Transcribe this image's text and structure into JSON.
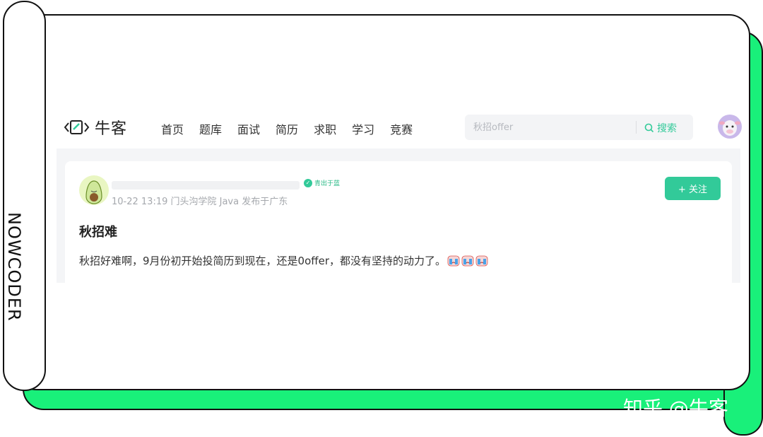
{
  "frame": {
    "side_label": "NOWCODER",
    "watermark": "知乎 @牛客",
    "accent_color": "#19f07a"
  },
  "header": {
    "logo_text": "牛客",
    "nav": [
      "首页",
      "题库",
      "面试",
      "简历",
      "求职",
      "学习",
      "竞赛"
    ],
    "search": {
      "placeholder": "秋招offer",
      "button_label": "搜索"
    },
    "brand_color": "#32ca99"
  },
  "post": {
    "badge": "青出于蓝",
    "meta": "10-22 13:19 门头沟学院 Java 发布于广东",
    "follow_label": "+ 关注",
    "title": "秋招难",
    "body": "秋招好难啊，9月份初开始投简历到现在，还是0offer，都没有坚持的动力了。",
    "emoji_icons": [
      "crying-face-icon",
      "crying-face-icon",
      "crying-face-icon"
    ]
  }
}
